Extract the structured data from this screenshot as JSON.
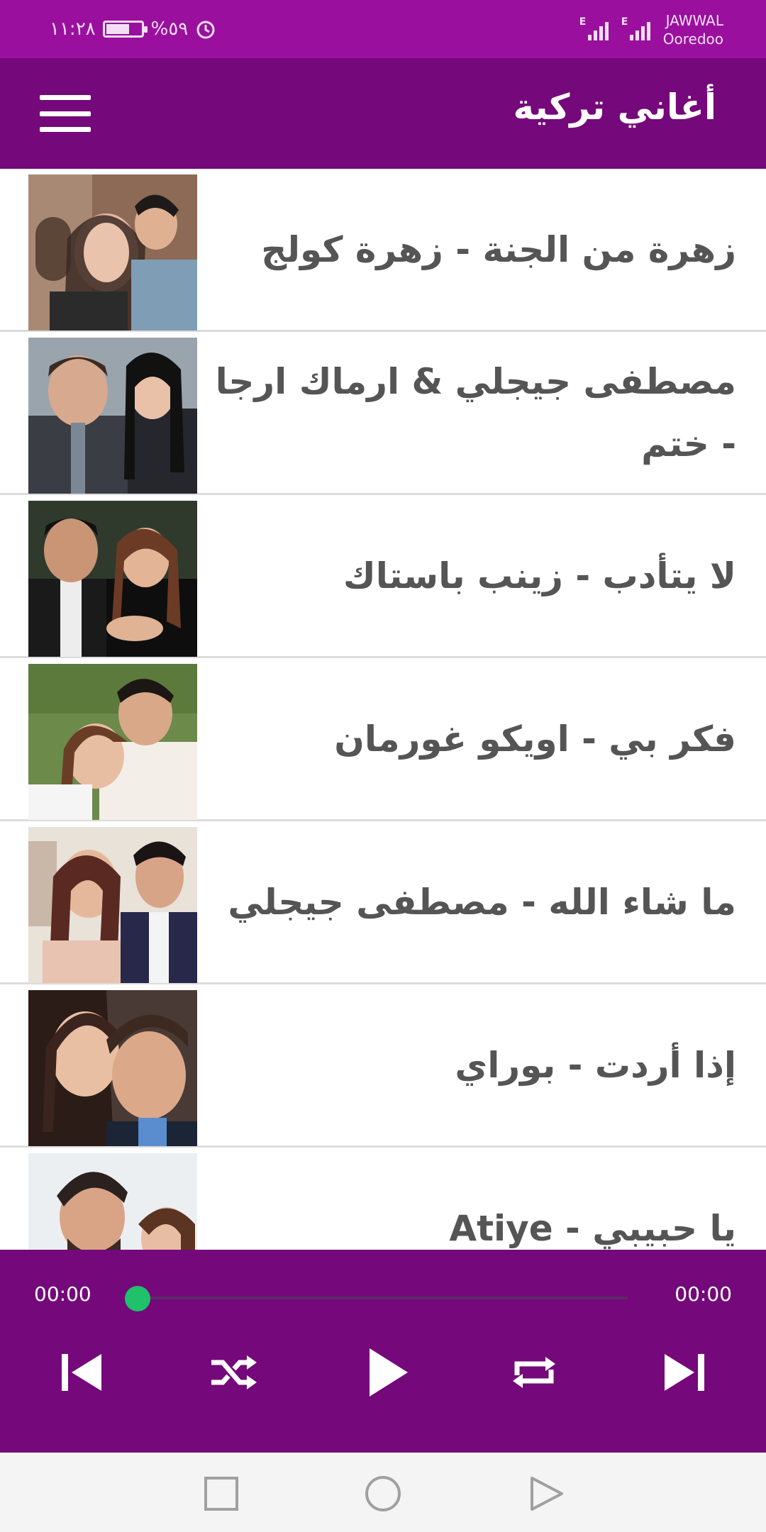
{
  "status_bar": {
    "time": "١١:٢٨",
    "battery_percent": "%٥٩",
    "carrier_1": "JAWWAL",
    "carrier_2": "Ooredoo",
    "network_1": "E",
    "network_2": "E"
  },
  "app_bar": {
    "title": "أغاني تركية",
    "menu_icon": "hamburger-menu-icon"
  },
  "songs": [
    {
      "title": "زهرة من الجنة - زهرة كولج"
    },
    {
      "title": "مصطفى جيجلي & ارماك ارجا - ختم"
    },
    {
      "title": "لا يتأدب - زينب باستاك"
    },
    {
      "title": "فكر بي - اويكو غورمان"
    },
    {
      "title": "ما شاء الله - مصطفى جيجلي"
    },
    {
      "title": "إذا أردت - بوراي"
    },
    {
      "title": "يا حبيبي - Atiye"
    }
  ],
  "player": {
    "current_time": "00:00",
    "duration": "00:00",
    "progress": 0,
    "controls": [
      "skip-previous-icon",
      "shuffle-icon",
      "play-icon",
      "repeat-icon",
      "skip-next-icon"
    ]
  },
  "nav_bar": {
    "buttons": [
      "recents-square-icon",
      "home-circle-icon",
      "back-triangle-icon"
    ]
  },
  "colors": {
    "status_bar": "#9a0f9e",
    "app_bar": "#75087a",
    "player": "#75087a",
    "progress_knob": "#1fc16b",
    "song_text": "#555555"
  }
}
